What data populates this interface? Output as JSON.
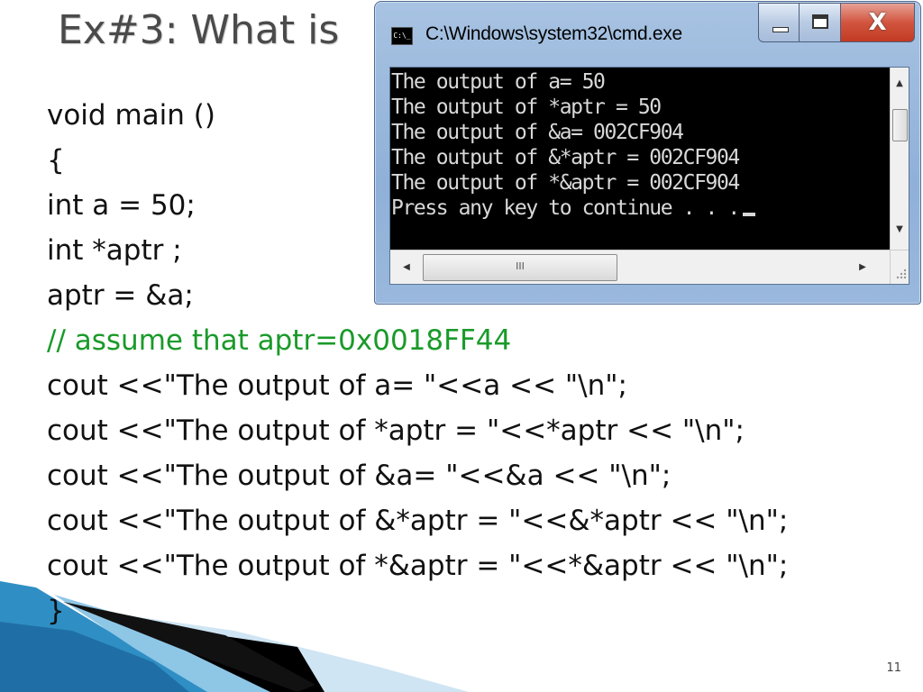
{
  "slide": {
    "title": "Ex#3: What is",
    "page_number": "11",
    "code_lines": [
      "void main ()",
      "{",
      "int a = 50;",
      "int *aptr ;",
      "aptr = &a;",
      "// assume that aptr=0x0018FF44",
      "cout <<\"The output of a= \"<<a << \"\\n\";",
      "cout <<\"The output of *aptr = \"<<*aptr << \"\\n\";",
      "cout <<\"The output of &a= \"<<&a << \"\\n\";",
      "cout <<\"The output of &*aptr = \"<<&*aptr << \"\\n\";",
      "cout <<\"The output of *&aptr = \"<<*&aptr << \"\\n\";",
      "}"
    ],
    "comment_color": "#1a9a2a"
  },
  "cmd_window": {
    "title": "C:\\Windows\\system32\\cmd.exe",
    "icon": "cmd-icon",
    "icon_text": "C:\\_",
    "buttons": {
      "minimize": "minimize-icon",
      "maximize": "maximize-icon",
      "close": "close-icon",
      "close_glyph": "X"
    },
    "console_lines": [
      "The output of a= 50",
      "The output of *aptr = 50",
      "The output of &a= 002CF904",
      "The output of &*aptr = 002CF904",
      "The output of *&aptr = 002CF904",
      "Press any key to continue . . ."
    ],
    "scrollbar": {
      "up_arrow": "▲",
      "down_arrow": "▼",
      "left_arrow": "◀",
      "right_arrow": "▶",
      "thumb_grip": "III"
    },
    "close_button_color": "#c8452e"
  }
}
